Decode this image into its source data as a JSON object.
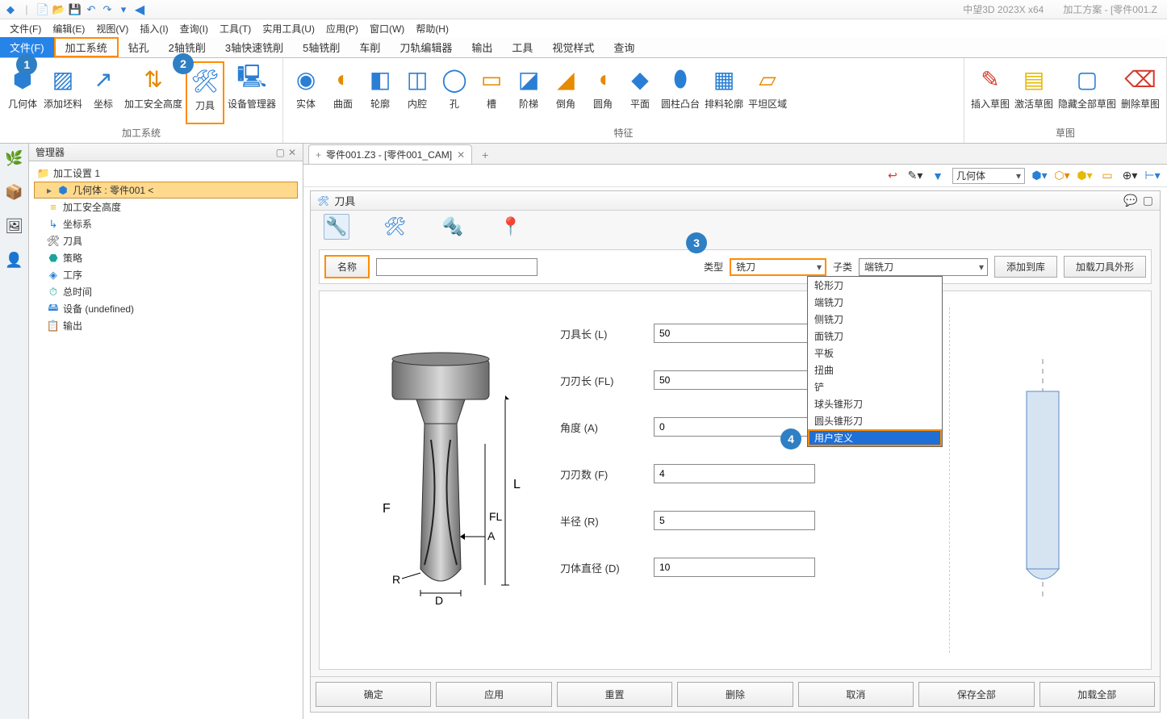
{
  "title": {
    "app": "中望3D 2023X x64",
    "scheme": "加工方案 - [零件001.Z"
  },
  "menu": [
    "文件(F)",
    "编辑(E)",
    "视图(V)",
    "插入(I)",
    "查询(I)",
    "工具(T)",
    "实用工具(U)",
    "应用(P)",
    "窗口(W)",
    "帮助(H)"
  ],
  "ribbon_tabs": [
    "文件(F)",
    "加工系统",
    "钻孔",
    "2轴铣削",
    "3轴快速铣削",
    "5轴铣削",
    "车削",
    "刀轨编辑器",
    "输出",
    "工具",
    "视觉样式",
    "查询"
  ],
  "ribbon_groups": {
    "g1": {
      "name": "加工系统",
      "items": [
        "几何体",
        "添加坯料",
        "坐标",
        "加工安全高度",
        "刀具",
        "设备管理器"
      ]
    },
    "g2": {
      "name": "特征",
      "items": [
        "实体",
        "曲面",
        "轮廓",
        "内腔",
        "孔",
        "槽",
        "阶梯",
        "倒角",
        "圆角",
        "平面",
        "圆柱凸台",
        "排料轮廓",
        "平坦区域"
      ]
    },
    "g3": {
      "name": "草图",
      "items": [
        "插入草图",
        "激活草图",
        "隐藏全部草图",
        "删除草图"
      ]
    }
  },
  "manager": {
    "title": "管理器",
    "tree": {
      "root": "加工设置 1",
      "items": [
        {
          "icon": "cube",
          "label": "几何体 : 零件001 <",
          "selected": true
        },
        {
          "icon": "layers",
          "label": "加工安全高度"
        },
        {
          "icon": "axis",
          "label": "坐标系"
        },
        {
          "icon": "tool",
          "label": "刀具"
        },
        {
          "icon": "strategy",
          "label": "策略"
        },
        {
          "icon": "op",
          "label": "工序"
        },
        {
          "icon": "time",
          "label": "总时间"
        },
        {
          "icon": "device",
          "label": "设备 (undefined)"
        },
        {
          "icon": "output",
          "label": "输出"
        }
      ]
    }
  },
  "doc_tab": {
    "label": "零件001.Z3 - [零件001_CAM]"
  },
  "viewport": {
    "select_label": "几何体"
  },
  "tool_dialog": {
    "title": "刀具",
    "name_btn": "名称",
    "type_label": "类型",
    "type_value": "铣刀",
    "subtype_label": "子类",
    "subtype_value": "端铣刀",
    "add_to_lib": "添加到库",
    "load_contour": "加载刀具外形",
    "dropdown": [
      "轮形刀",
      "端铣刀",
      "侧铣刀",
      "面铣刀",
      "平板",
      "扭曲",
      "铲",
      "球头锥形刀",
      "圆头锥形刀",
      "用户定义"
    ],
    "fields": [
      {
        "label": "刀具长 (L)",
        "value": "50"
      },
      {
        "label": "刀刃长 (FL)",
        "value": "50"
      },
      {
        "label": "角度 (A)",
        "value": "0"
      },
      {
        "label": "刀刃数 (F)",
        "value": "4"
      },
      {
        "label": "半径 (R)",
        "value": "5"
      },
      {
        "label": "刀体直径 (D)",
        "value": "10"
      }
    ],
    "footer": [
      "确定",
      "应用",
      "重置",
      "删除",
      "取消",
      "保存全部",
      "加载全部"
    ]
  },
  "badges": {
    "b1": "1",
    "b2": "2",
    "b3": "3",
    "b4": "4"
  }
}
